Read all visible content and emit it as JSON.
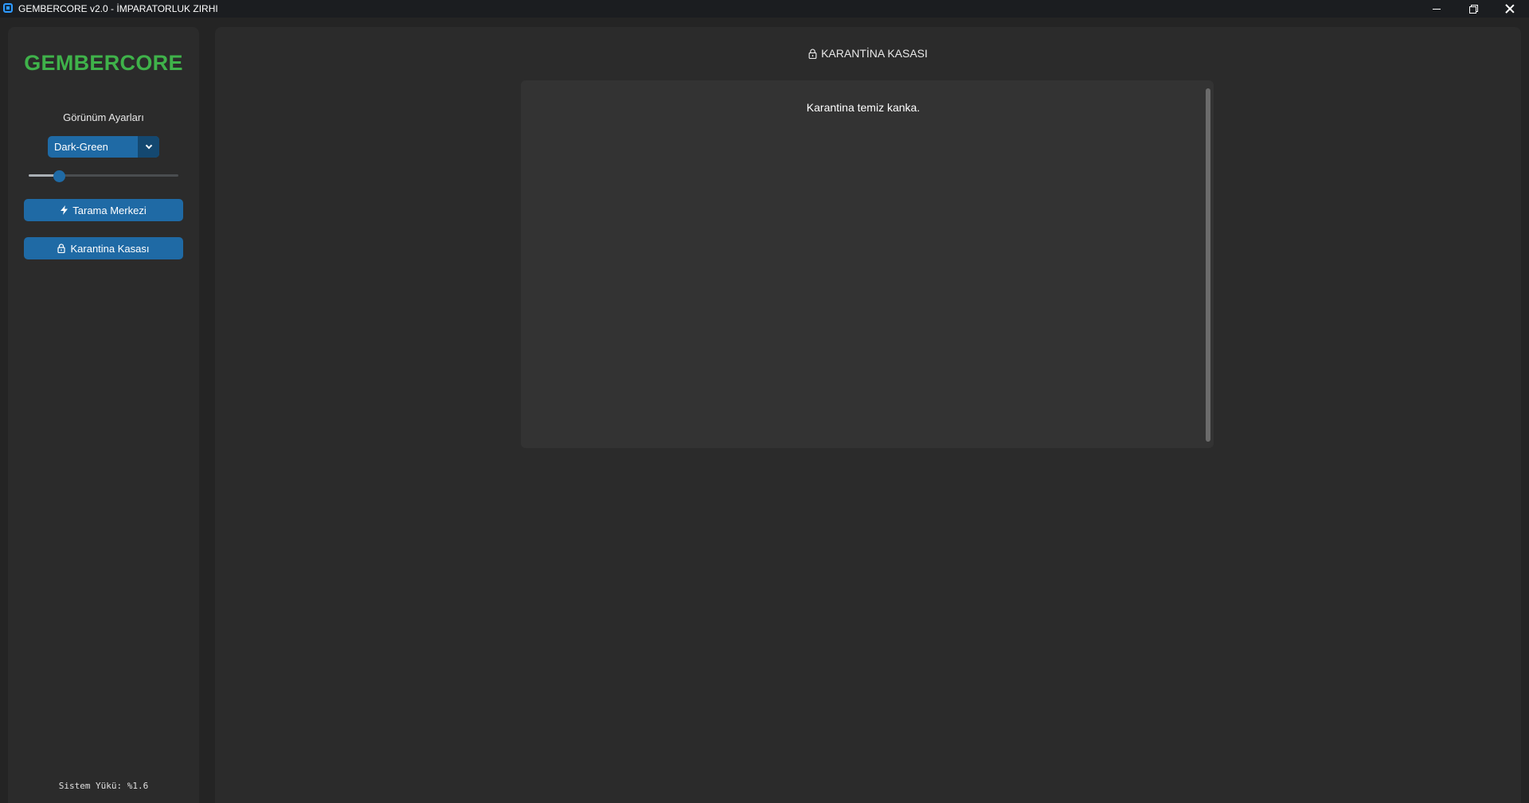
{
  "window": {
    "title": "GEMBERCORE v2.0 - İMPARATORLUK ZIRHI",
    "controls": [
      "minimize",
      "maximize",
      "close"
    ]
  },
  "sidebar": {
    "brand": "GEMBERCORE",
    "settings_label": "Görünüm Ayarları",
    "theme_select": {
      "value": "Dark-Green",
      "icon": "chevron-down-icon"
    },
    "scale_slider": {
      "value_fraction": 0.2
    },
    "nav": [
      {
        "label": "Tarama Merkezi",
        "icon": "lightning-icon"
      },
      {
        "label": "Karantina Kasası",
        "icon": "lock-icon"
      }
    ],
    "system_load": "Sistem Yükü: %1.6"
  },
  "main": {
    "title": "KARANTİNA KASASI",
    "title_icon": "lock-icon",
    "vault_message": "Karantina temiz kanka."
  },
  "colors": {
    "accent": "#1f6aa5",
    "brand": "#3fb24a",
    "background": "#242424",
    "panel": "#2b2b2b"
  }
}
